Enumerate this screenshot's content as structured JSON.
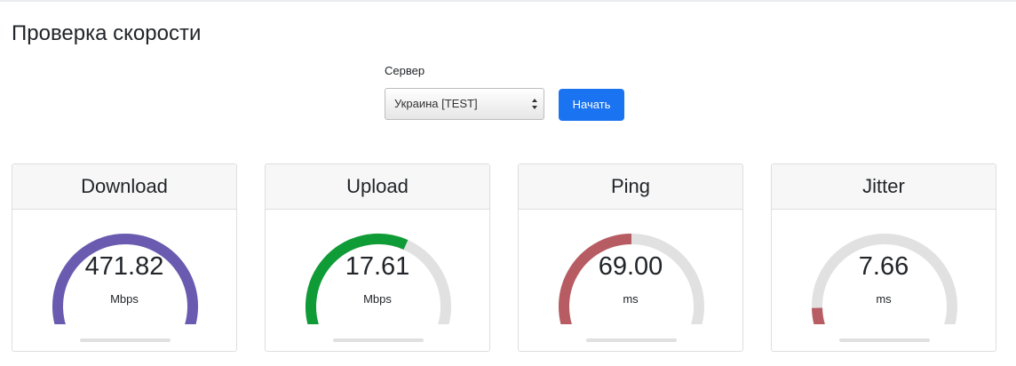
{
  "page": {
    "title": "Проверка скорости"
  },
  "server": {
    "label": "Сервер",
    "selected": "Украина [TEST]"
  },
  "start_button": {
    "label": "Начать",
    "color": "#1a73f0"
  },
  "cards": [
    {
      "title": "Download",
      "value": "471.82",
      "unit": "Mbps",
      "gauge_fraction": 1.0,
      "color": "#6a5bb0"
    },
    {
      "title": "Upload",
      "value": "17.61",
      "unit": "Mbps",
      "gauge_fraction": 0.6,
      "color": "#0f9b35"
    },
    {
      "title": "Ping",
      "value": "69.00",
      "unit": "ms",
      "gauge_fraction": 0.5,
      "color": "#b85c63"
    },
    {
      "title": "Jitter",
      "value": "7.66",
      "unit": "ms",
      "gauge_fraction": 0.12,
      "color": "#b85c63"
    }
  ],
  "gauge_track_color": "#e1e1e1"
}
